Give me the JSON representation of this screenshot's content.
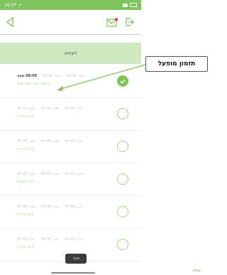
{
  "status_bar": {
    "time": "16:57 ↗"
  },
  "header": {
    "banner": "דצמא"
  },
  "rows": [
    {
      "active": true,
      "time": "00:00 שעה",
      "c2": "שעה 00:00",
      "c3": "שעה 00:00",
      "sub": "תזמון: יום ראשון שבת"
    },
    {
      "active": false,
      "time": "שעה 00:00",
      "c2": "שעה 00:00",
      "c3": "שעה 00:00",
      "sub": "[לא נבחר]"
    },
    {
      "active": false,
      "time": "שעה 00:00",
      "c2": "שעה 00:00",
      "c3": "שעה 00:00",
      "sub": "[לא נבחר]"
    },
    {
      "active": false,
      "time": "שעה 00:00",
      "c2": "שעה 00:00",
      "c3": "שעה 00:00",
      "sub": "[לא נבחר]"
    },
    {
      "active": false,
      "time": "שעה 00:00",
      "c2": "שעה 00:00",
      "c3": "שעה 00:00",
      "sub": "[לא נבחר]"
    },
    {
      "active": false,
      "time": "שעה 00:00",
      "c2": "שעה 00:00",
      "c3": "שעה 00:00",
      "sub": "[לא נבחר]"
    }
  ],
  "close_button": "סגור",
  "callout": "תזמון מופעל",
  "footer": "שיווק",
  "colors": {
    "accent": "#7fc45c",
    "banner_bg": "#cfe9c2"
  }
}
